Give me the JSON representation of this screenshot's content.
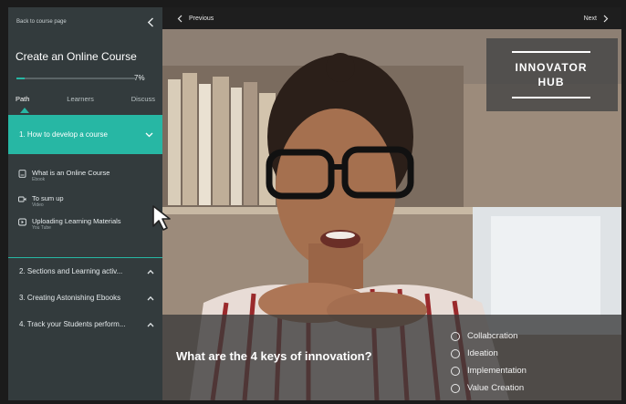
{
  "sidebar": {
    "back_link": "Back to course page",
    "course_title": "Create an Online Course",
    "progress_percent": 7,
    "progress_label": "7%",
    "tabs": [
      {
        "label": "Path",
        "active": true
      },
      {
        "label": "Learners",
        "active": false
      },
      {
        "label": "Discuss",
        "active": false
      }
    ],
    "active_section": {
      "label": "1. How to develop a course",
      "lessons": [
        {
          "title": "What is an Online Course",
          "type": "Ebook",
          "icon": "ebook-icon"
        },
        {
          "title": "To sum up",
          "type": "Video",
          "icon": "video-icon"
        },
        {
          "title": "Uploading Learning Materials",
          "type": "You Tube",
          "icon": "youtube-icon"
        }
      ]
    },
    "sections": [
      {
        "label": "2. Sections and Learning activ..."
      },
      {
        "label": "3. Creating Astonishing Ebooks"
      },
      {
        "label": "4. Track your Students perform..."
      }
    ]
  },
  "video": {
    "prev_label": "Previous",
    "next_label": "Next",
    "logo_line1": "INNOVATOR",
    "logo_line2": "HUB",
    "question": "What are the 4 keys of innovation?",
    "options": [
      "Collabcration",
      "Ideation",
      "Implementation",
      "Value Creation"
    ]
  },
  "colors": {
    "accent": "#27b7a4",
    "sidebar_bg": "#333b3d",
    "topbar_bg": "#1e1e1e"
  }
}
